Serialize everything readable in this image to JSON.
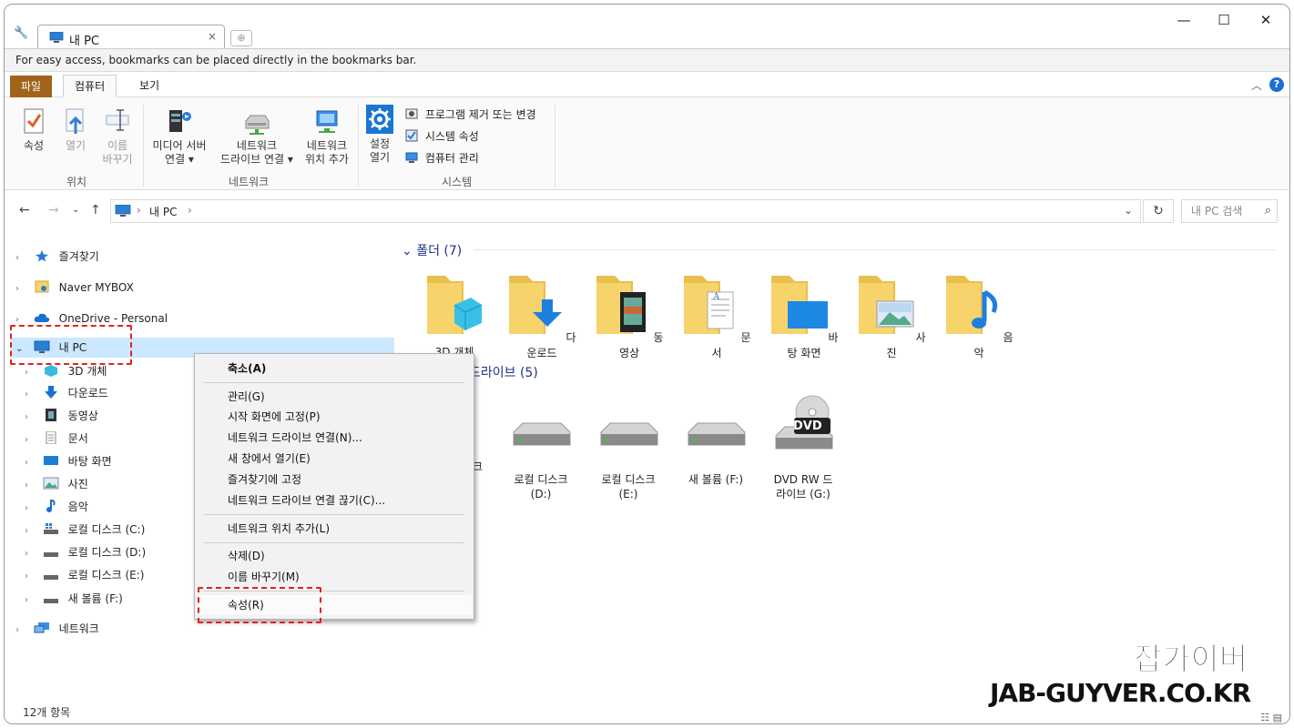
{
  "window": {
    "tab_title": "내 PC",
    "tab_close": "×",
    "minimize": "—",
    "maximize": "☐",
    "close": "✕"
  },
  "bookmark_bar": {
    "text": "For easy access, bookmarks can be placed directly in the bookmarks bar."
  },
  "ribbon_tabs": {
    "file": "파일",
    "computer": "컴퓨터",
    "view": "보기"
  },
  "ribbon": {
    "location": {
      "group_label": "위치",
      "properties": "속성",
      "open": "열기",
      "rename": "이름\n바꾸기"
    },
    "network": {
      "group_label": "네트워크",
      "media_server": "미디어 서버\n연결 ▾",
      "map_drive": "네트워크\n드라이브 연결 ▾",
      "add_location": "네트워크\n위치 추가"
    },
    "system": {
      "group_label": "시스템",
      "settings": "설정\n열기",
      "uninstall": "프로그램 제거 또는 변경",
      "system_properties": "시스템 속성",
      "computer_management": "컴퓨터 관리"
    }
  },
  "address": {
    "crumb_pc": "내 PC",
    "search_placeholder": "내 PC 검색"
  },
  "nav": {
    "favorites": "즐겨찾기",
    "mybox": "Naver MYBOX",
    "onedrive": "OneDrive - Personal",
    "this_pc": "내 PC",
    "objects3d": "3D 개체",
    "downloads": "다운로드",
    "videos": "동영상",
    "documents": "문서",
    "desktop": "바탕 화면",
    "pictures": "사진",
    "music": "음악",
    "disk_c": "로컬 디스크 (C:)",
    "disk_d": "로컬 디스크 (D:)",
    "disk_e": "로컬 디스크 (E:)",
    "vol_f": "새 볼륨 (F:)",
    "network": "네트워크"
  },
  "content": {
    "folders_header": "폴더 (7)",
    "drives_header": "드라이브 (5)",
    "folders": [
      "3D 개체",
      "다운로드",
      "동영상",
      "문서",
      "바탕 화면",
      "사진",
      "음악"
    ],
    "drive_c_partial": "크",
    "drive_d": "로컬 디스크\n(D:)",
    "drive_e": "로컬 디스크\n(E:)",
    "drive_f": "새 볼륨 (F:)",
    "drive_g": "DVD RW 드\n라이브 (G:)",
    "dvd_badge": "DVD"
  },
  "context_menu": {
    "collapse": "축소(A)",
    "manage": "관리(G)",
    "pin_start": "시작 화면에 고정(P)",
    "map_drive": "네트워크 드라이브 연결(N)...",
    "new_window": "새 창에서 열기(E)",
    "pin_quick": "즐겨찾기에 고정",
    "disconnect_drive": "네트워크 드라이브 연결 끊기(C)...",
    "add_net_location": "네트워크 위치 추가(L)",
    "delete": "삭제(D)",
    "rename": "이름 바꾸기(M)",
    "properties": "속성(R)"
  },
  "status": {
    "item_count": "12개 항목"
  },
  "watermark": {
    "line1": "잡가이버",
    "line2": "JAB-GUYVER.CO.KR"
  },
  "colors": {
    "file_tab": "#a0631a",
    "selection": "#cce8ff",
    "section_header": "#1e3287",
    "highlight_dash": "#e0231c",
    "folder_yellow": "#f7d36b",
    "help_blue": "#1e6fd1"
  }
}
